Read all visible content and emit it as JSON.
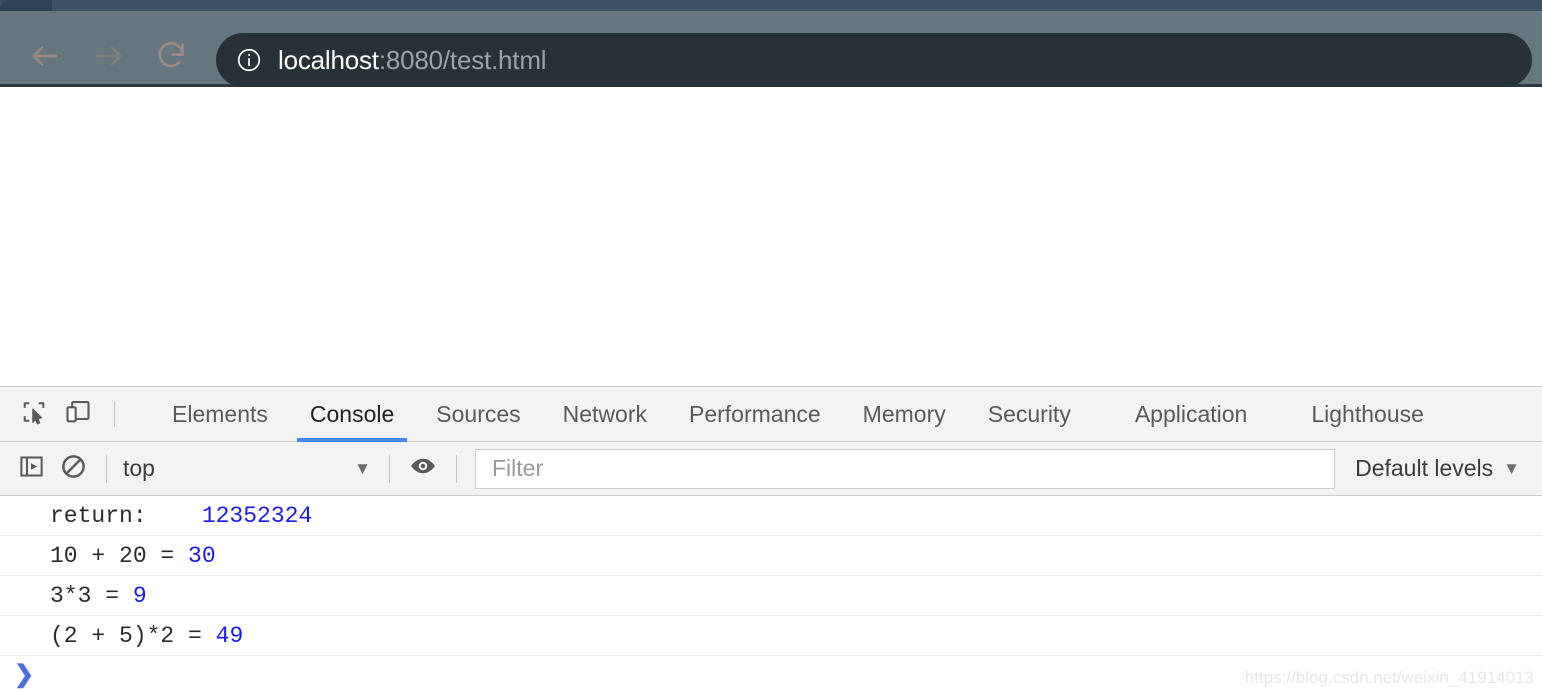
{
  "browser": {
    "nav": {
      "back_icon": "arrow-left-icon",
      "forward_icon": "arrow-right-icon",
      "reload_icon": "reload-icon"
    },
    "omnibox": {
      "info_icon": "info-circle-icon",
      "host": "localhost",
      "path": ":8080/test.html",
      "full_url": "localhost:8080/test.html"
    }
  },
  "devtools": {
    "tools": [
      {
        "name": "inspect-element-icon",
        "label": "Inspect element"
      },
      {
        "name": "device-toolbar-icon",
        "label": "Toggle device toolbar"
      }
    ],
    "tabs": [
      {
        "label": "Elements",
        "active": false
      },
      {
        "label": "Console",
        "active": true
      },
      {
        "label": "Sources",
        "active": false
      },
      {
        "label": "Network",
        "active": false
      },
      {
        "label": "Performance",
        "active": false
      },
      {
        "label": "Memory",
        "active": false
      },
      {
        "label": "Security",
        "active": false
      },
      {
        "label": "Application",
        "active": false
      },
      {
        "label": "Lighthouse",
        "active": false
      }
    ],
    "accent_color": "#4285f4"
  },
  "console": {
    "toolbar": {
      "sidebar_toggle_icon": "console-sidebar-icon",
      "clear_icon": "clear-console-icon",
      "context": "top",
      "context_caret": "▼",
      "eye_icon": "eye-icon",
      "filter_value": "",
      "filter_placeholder": "Filter",
      "levels_label": "Default levels",
      "levels_caret": "▼"
    },
    "messages": [
      {
        "text": "return:    ",
        "value": "12352324"
      },
      {
        "text": "10 + 20 = ",
        "value": "30"
      },
      {
        "text": "3*3 = ",
        "value": "9"
      },
      {
        "text": "(2 + 5)*2 = ",
        "value": "49"
      }
    ],
    "prompt": {
      "chevron": "❯",
      "input_value": ""
    },
    "value_color": "#1a1aee"
  },
  "watermark": {
    "text": "https://blog.csdn.net/weixin_41914013"
  }
}
